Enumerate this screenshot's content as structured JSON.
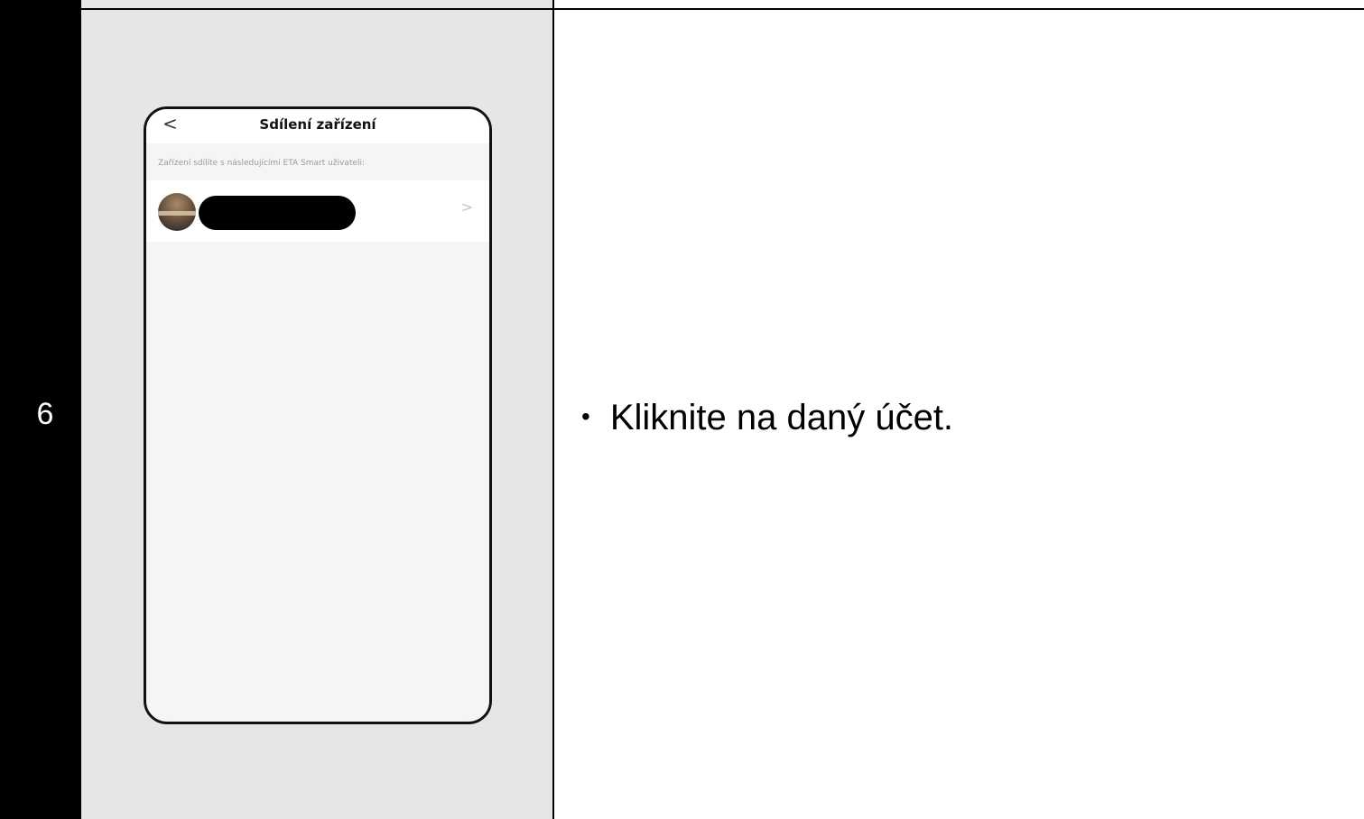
{
  "step": {
    "number": "6"
  },
  "instruction": {
    "bullet": "•",
    "text": "Kliknite na daný účet."
  },
  "phone": {
    "header": {
      "back_icon": "chevron-left-icon",
      "back_glyph": "<",
      "title": "Sdílení zařízení"
    },
    "subtitle": "Zařízení sdílíte s následujícími ETA Smart uživateli:",
    "shared_users": [
      {
        "avatar": "user-avatar",
        "name_redacted": true,
        "chevron_glyph": ">"
      }
    ]
  },
  "colors": {
    "image_cell_background": "#e6e6e6",
    "phone_background": "#f5f5f5",
    "border": "#000000"
  }
}
